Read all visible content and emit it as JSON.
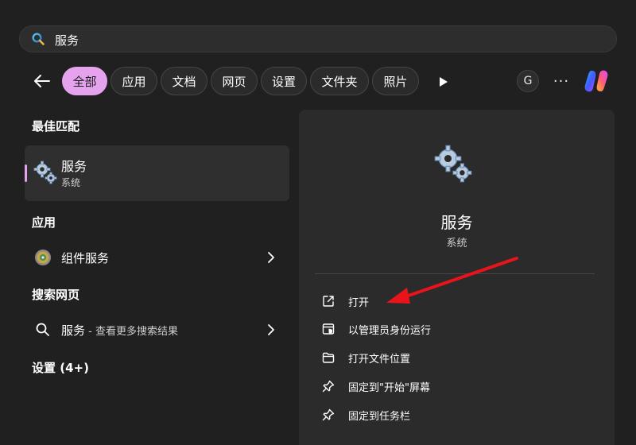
{
  "search": {
    "query": "服务"
  },
  "filters": {
    "items": [
      "全部",
      "应用",
      "文档",
      "网页",
      "设置",
      "文件夹",
      "照片"
    ],
    "active": "全部"
  },
  "header": {
    "account_initial": "G",
    "more_label": "···"
  },
  "best_match": {
    "heading": "最佳匹配",
    "title": "服务",
    "subtitle": "系统"
  },
  "apps": {
    "heading": "应用",
    "items": [
      {
        "label": "组件服务"
      }
    ]
  },
  "web": {
    "heading": "搜索网页",
    "query": "服务",
    "hint": " - 查看更多搜索结果"
  },
  "settings": {
    "heading": "设置 (4+)"
  },
  "detail": {
    "title": "服务",
    "subtitle": "系统",
    "actions": [
      {
        "label": "打开",
        "icon": "open-external-icon"
      },
      {
        "label": "以管理员身份运行",
        "icon": "run-as-admin-icon"
      },
      {
        "label": "打开文件位置",
        "icon": "folder-icon"
      },
      {
        "label": "固定到\"开始\"屏幕",
        "icon": "pin-icon"
      },
      {
        "label": "固定到任务栏",
        "icon": "pin-icon"
      }
    ]
  },
  "colors": {
    "background": "#202020",
    "panel": "#2b2b2b",
    "accent": "#e4a3ec",
    "annotation_arrow": "#e8131b"
  }
}
